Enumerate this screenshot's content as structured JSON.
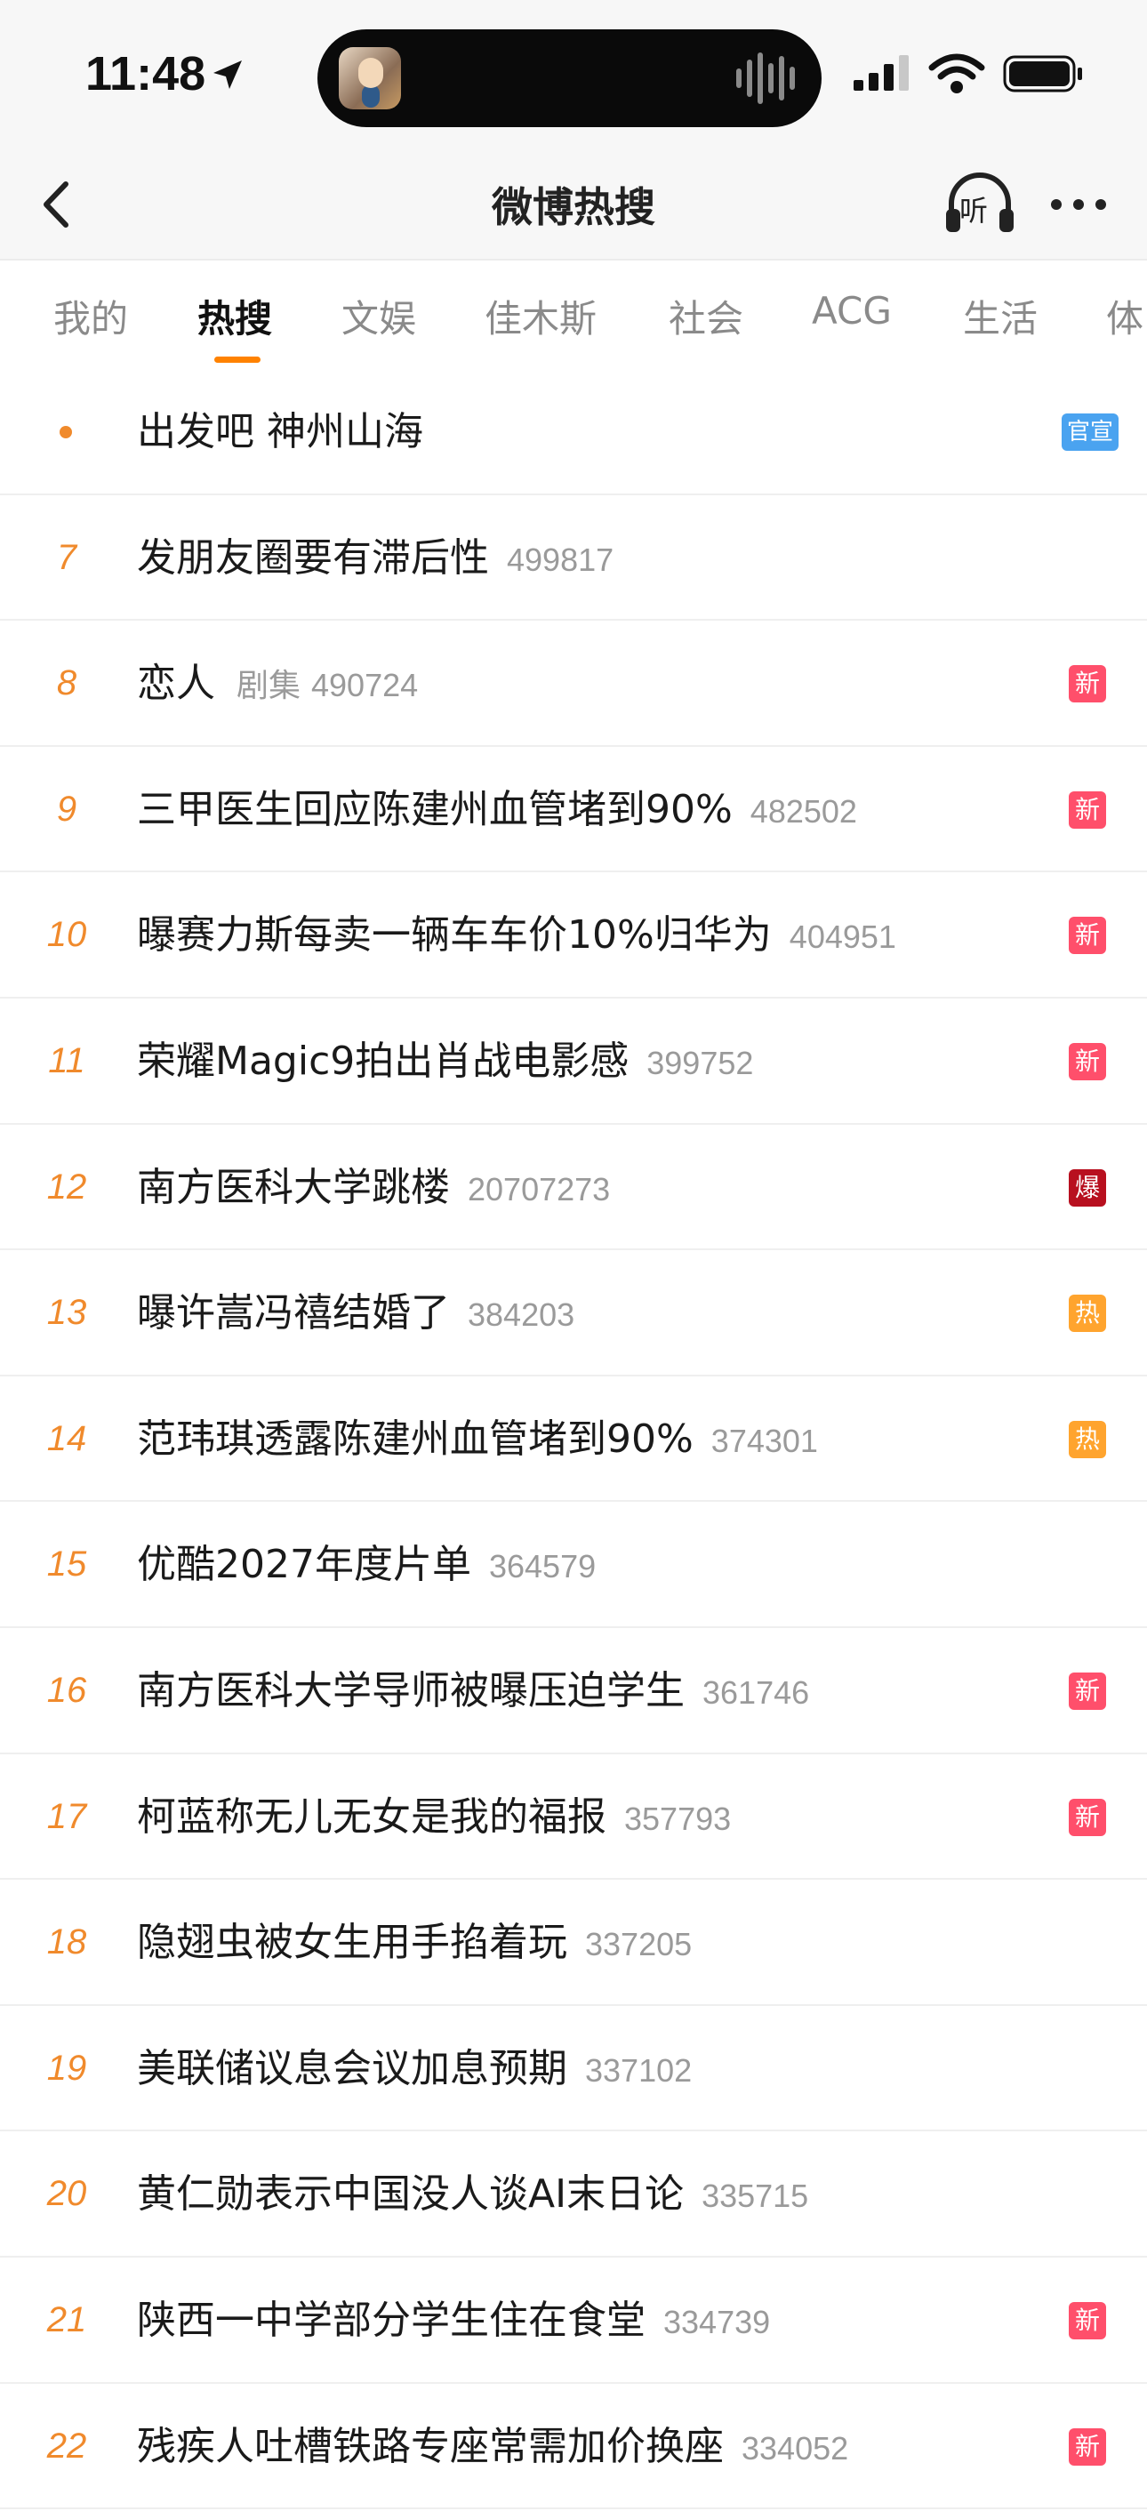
{
  "status_bar": {
    "time": "11:48",
    "icons": [
      "location-arrow-icon",
      "signal-icon",
      "wifi-icon",
      "battery-icon"
    ]
  },
  "header": {
    "title": "微博热搜",
    "listen_label": "听",
    "icons": [
      "back-icon",
      "headphones-icon",
      "more-icon"
    ]
  },
  "tabs": [
    "我的",
    "热搜",
    "文娱",
    "佳木斯",
    "社会",
    "ACG",
    "生活",
    "体"
  ],
  "active_tab": "热搜",
  "colors": {
    "accent": "#ff8200",
    "rank": "#f08a2c",
    "badge_new": "#ff4f6b",
    "badge_explode": "#b8101f",
    "badge_hot": "#ffa42e",
    "badge_official": "#4aa3f0"
  },
  "items": [
    {
      "rank": "",
      "title": "出发吧 神州山海",
      "category": "",
      "heat": "",
      "badge": "官宣",
      "badge_type": "guan"
    },
    {
      "rank": "7",
      "title": "发朋友圈要有滞后性",
      "category": "",
      "heat": "499817",
      "badge": "",
      "badge_type": ""
    },
    {
      "rank": "8",
      "title": "恋人",
      "category": "剧集",
      "heat": "490724",
      "badge": "新",
      "badge_type": "xin"
    },
    {
      "rank": "9",
      "title": "三甲医生回应陈建州血管堵到90%",
      "category": "",
      "heat": "482502",
      "badge": "新",
      "badge_type": "xin"
    },
    {
      "rank": "10",
      "title": "曝赛力斯每卖一辆车车价10%归华为",
      "category": "",
      "heat": "404951",
      "badge": "新",
      "badge_type": "xin"
    },
    {
      "rank": "11",
      "title": "荣耀Magic9拍出肖战电影感",
      "category": "",
      "heat": "399752",
      "badge": "新",
      "badge_type": "xin"
    },
    {
      "rank": "12",
      "title": "南方医科大学跳楼",
      "category": "",
      "heat": "20707273",
      "badge": "爆",
      "badge_type": "bao"
    },
    {
      "rank": "13",
      "title": "曝许嵩冯禧结婚了",
      "category": "",
      "heat": "384203",
      "badge": "热",
      "badge_type": "re"
    },
    {
      "rank": "14",
      "title": "范玮琪透露陈建州血管堵到90%",
      "category": "",
      "heat": "374301",
      "badge": "热",
      "badge_type": "re"
    },
    {
      "rank": "15",
      "title": "优酷2027年度片单",
      "category": "",
      "heat": "364579",
      "badge": "",
      "badge_type": ""
    },
    {
      "rank": "16",
      "title": "南方医科大学导师被曝压迫学生",
      "category": "",
      "heat": "361746",
      "badge": "新",
      "badge_type": "xin"
    },
    {
      "rank": "17",
      "title": "柯蓝称无儿无女是我的福报",
      "category": "",
      "heat": "357793",
      "badge": "新",
      "badge_type": "xin"
    },
    {
      "rank": "18",
      "title": "隐翅虫被女生用手掐着玩",
      "category": "",
      "heat": "337205",
      "badge": "",
      "badge_type": ""
    },
    {
      "rank": "19",
      "title": "美联储议息会议加息预期",
      "category": "",
      "heat": "337102",
      "badge": "",
      "badge_type": ""
    },
    {
      "rank": "20",
      "title": "黄仁勋表示中国没人谈AI末日论",
      "category": "",
      "heat": "335715",
      "badge": "",
      "badge_type": ""
    },
    {
      "rank": "21",
      "title": "陕西一中学部分学生住在食堂",
      "category": "",
      "heat": "334739",
      "badge": "新",
      "badge_type": "xin"
    },
    {
      "rank": "22",
      "title": "残疾人吐槽铁路专座常需加价换座",
      "category": "",
      "heat": "334052",
      "badge": "新",
      "badge_type": "xin"
    }
  ]
}
